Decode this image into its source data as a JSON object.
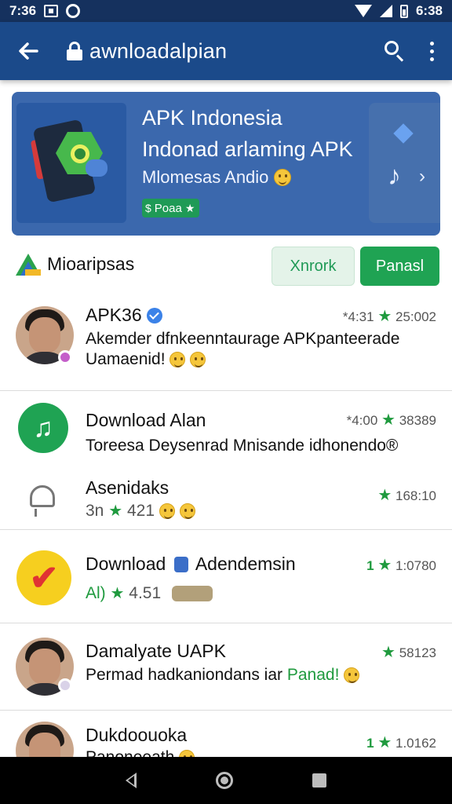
{
  "status_bar": {
    "time": "7:36",
    "battery_time": "6:38"
  },
  "app_bar": {
    "title": "awnloadalpian"
  },
  "banner": {
    "title": "APK Indonesia",
    "subtitle": "Indonad arlaming APK",
    "caption": "Mlomesas Andio",
    "badge": "Poaa"
  },
  "section": {
    "title": "Mioaripsas",
    "secondary_button": "Xnrork",
    "primary_button": "Panasl"
  },
  "items": [
    {
      "title": "APK36",
      "meta_prefix": "*4:31",
      "meta_suffix": "25:002",
      "line1": "Akemder dfnkeenntaurage APKpanteerade",
      "line2": "Uamaenid!"
    },
    {
      "title": "Download Alan",
      "meta_prefix": "*4:00",
      "meta_suffix": "38389",
      "line1": "Toreesa Deysenrad Mnisande idhonendo®"
    },
    {
      "title": "Asenidaks",
      "meta_suffix": "168:10",
      "line1_prefix": "3n",
      "line1_rating": "421"
    },
    {
      "title_prefix": "Download",
      "title_suffix": "Adendemsin",
      "meta_prefix": "1",
      "meta_suffix": "1:0780",
      "line1_prefix": "Al)",
      "line1_rating": "4.51"
    },
    {
      "title": "Damalyate UAPK",
      "meta_suffix": "58123",
      "line1_prefix": "Permad hadkaniondans iar",
      "line1_accent": "Panad!"
    },
    {
      "title": "Dukdoouoka",
      "meta_prefix": "1",
      "meta_suffix": "1.0162",
      "line1": "Panoneeath"
    }
  ],
  "colors": {
    "app_bar": "#1b4a8a",
    "status_bar": "#15315e",
    "accent_green": "#1fa353",
    "banner": "#3b68ad"
  }
}
